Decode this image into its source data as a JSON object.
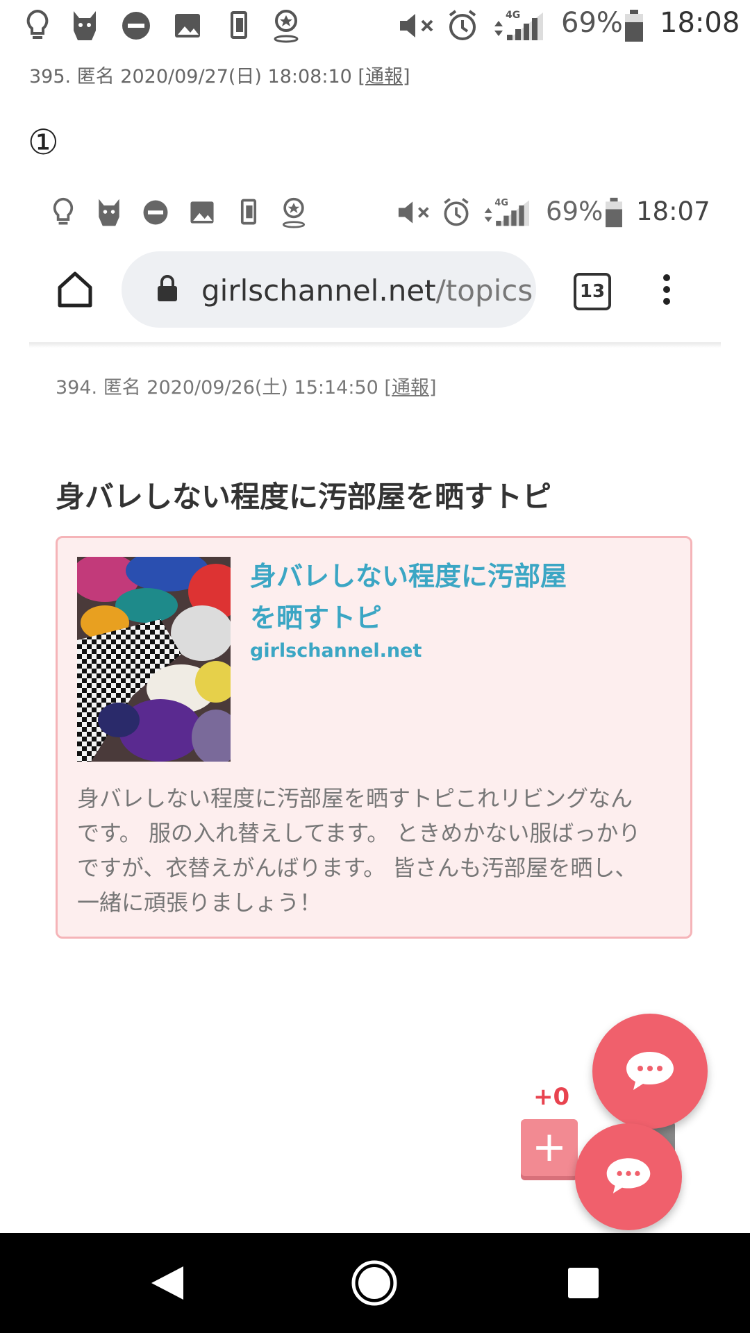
{
  "status_bar_outer": {
    "battery": "69%",
    "time": "18:08",
    "network": "4G"
  },
  "post_outer": {
    "meta": "395. 匿名 2020/09/27(日) 18:08:10",
    "report_link": "[通報]",
    "marker": "①"
  },
  "status_bar_inner": {
    "battery": "69%",
    "time": "18:07",
    "network": "4G"
  },
  "browser": {
    "url_domain": "girlschannel.net",
    "url_path": "/topics",
    "tab_count": "13"
  },
  "post_inner": {
    "meta": "394. 匿名 2020/09/26(土) 15:14:50",
    "report_link": "[通報]",
    "topic_title": "身バレしない程度に汚部屋を晒すトピ"
  },
  "link_card": {
    "title_line1": "身バレしない程度に汚部屋",
    "title_line2": "を晒すトピ",
    "domain": "girlschannel.net",
    "description_lines": [
      "身バレしない程度に汚部屋を晒すトピこれリビングなん",
      "です。 服の入れ替えしてます。 ときめかない服ばっかり",
      "ですが、衣替えがんばります。 皆さんも汚部屋を晒し、",
      "一緒に頑張りましょう！"
    ]
  },
  "actions": {
    "plus_count": "+0",
    "plus_label": "+"
  },
  "colors": {
    "accent_link": "#3ba6c4",
    "fab": "#f0606c",
    "card_bg": "#fdeeee",
    "card_border": "#f5b4b8"
  }
}
